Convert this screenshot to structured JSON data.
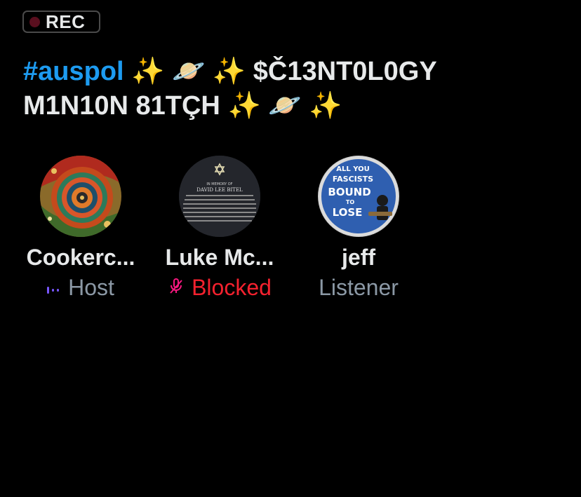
{
  "recording": {
    "label": "REC",
    "dot_color": "#5a0f1f"
  },
  "space": {
    "title_hashtag": "#auspol",
    "title_line1_emojis_a": "✨ 🪐 ✨",
    "title_line1_text": "$Č13NT0L0GY",
    "title_line2_text": "M1N10N 81TÇH",
    "title_line2_emojis": "✨ 🪐 ✨"
  },
  "colors": {
    "hashtag": "#1d9bf0",
    "primary_text": "#e7e9ea",
    "muted_text": "#8b98a5",
    "blocked": "#f4212e",
    "host_icon": "#7856ff"
  },
  "participants": [
    {
      "name": "Cookerc...",
      "role": "Host",
      "role_icon": "speaker-bars-icon",
      "avatar": "spiral-art-avatar"
    },
    {
      "name": "Luke Mc...",
      "role": "Blocked",
      "role_icon": "muted-mic-icon",
      "avatar": "memorial-plaque-avatar",
      "plaque_text": [
        "IN MEMORY OF",
        "DAVID LEE BITEL"
      ]
    },
    {
      "name": "jeff",
      "role": "Listener",
      "role_icon": "",
      "avatar": "fascists-sticker-avatar",
      "sticker_text": [
        "ALL YOU",
        "FASCISTS",
        "BOUND",
        "TO",
        "LOSE"
      ]
    }
  ]
}
